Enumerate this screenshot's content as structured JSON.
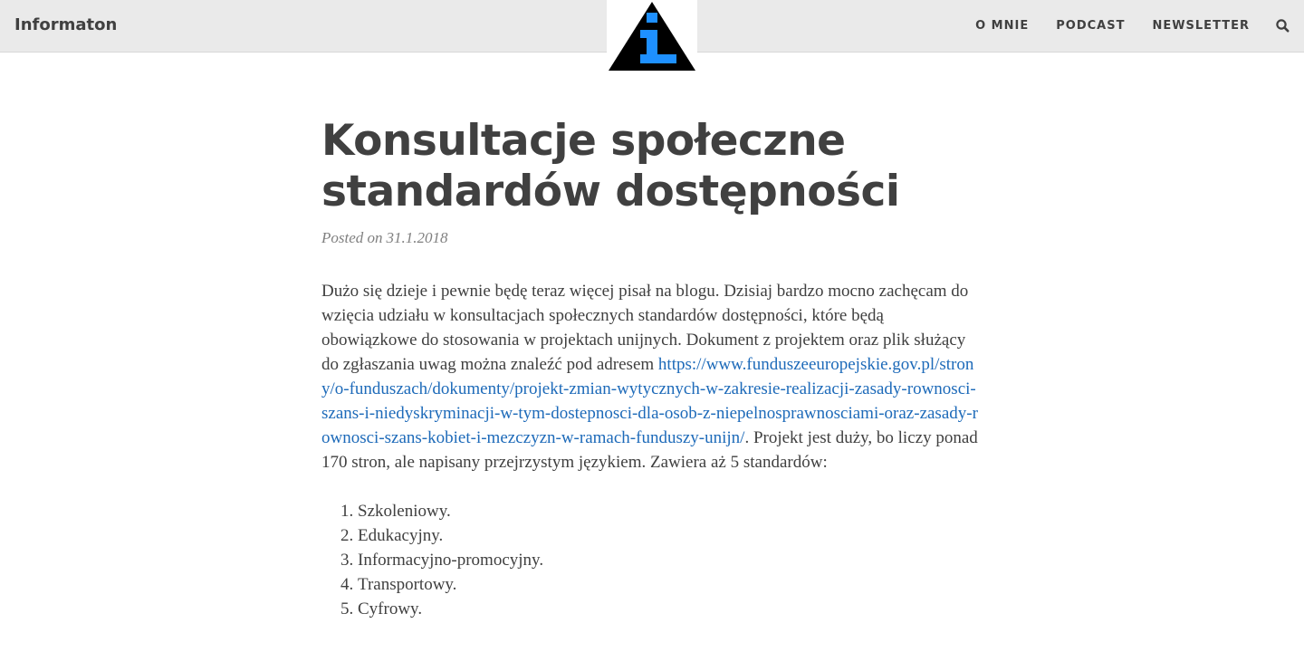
{
  "header": {
    "brand": "Informaton",
    "nav": [
      {
        "label": "O MNIE"
      },
      {
        "label": "PODCAST"
      },
      {
        "label": "NEWSLETTER"
      }
    ],
    "search_icon": "search-icon",
    "logo_icon": "info-triangle-logo-icon",
    "colors": {
      "nav_bg": "#eaeaea",
      "logo_triangle": "#000000",
      "logo_i": "#1e90ff"
    }
  },
  "article": {
    "title": "Konsultacje społeczne standardów dostępności",
    "posted_label": "Posted on",
    "date": "31.1.2018",
    "paragraph_intro": "Dużo się dzieje i pewnie będę teraz więcej pisał na blogu. Dzisiaj bardzo mocno zachęcam do wzięcia udziału w konsultacjach społecznych standardów dostępności, które będą obowiązkowe do stosowania w projektach unijnych. Dokument z projektem oraz plik służący do zgłaszania uwag można znaleźć pod adresem",
    "link": "https://www.funduszeeuropejskie.gov.pl/strony/o-funduszach/dokumenty/projekt-zmian-wytycznych-w-zakresie-realizacji-zasady-rownosci-szans-i-niedyskryminacji-w-tym-dostepnosci-dla-osob-z-niepelnosprawnosciami-oraz-zasady-rownosci-szans-kobiet-i-mezczyzn-w-ramach-funduszy-unijn/",
    "paragraph_outro": ". Projekt jest duży, bo liczy ponad 170 stron, ale napisany przejrzystym językiem. Zawiera aż 5 standardów:",
    "standards": [
      "Szkoleniowy.",
      "Edukacyjny.",
      "Informacyjno-promocyjny.",
      "Transportowy.",
      "Cyfrowy."
    ],
    "colors": {
      "link": "#1d6ab9",
      "meta": "#808080",
      "text": "#404040"
    }
  }
}
